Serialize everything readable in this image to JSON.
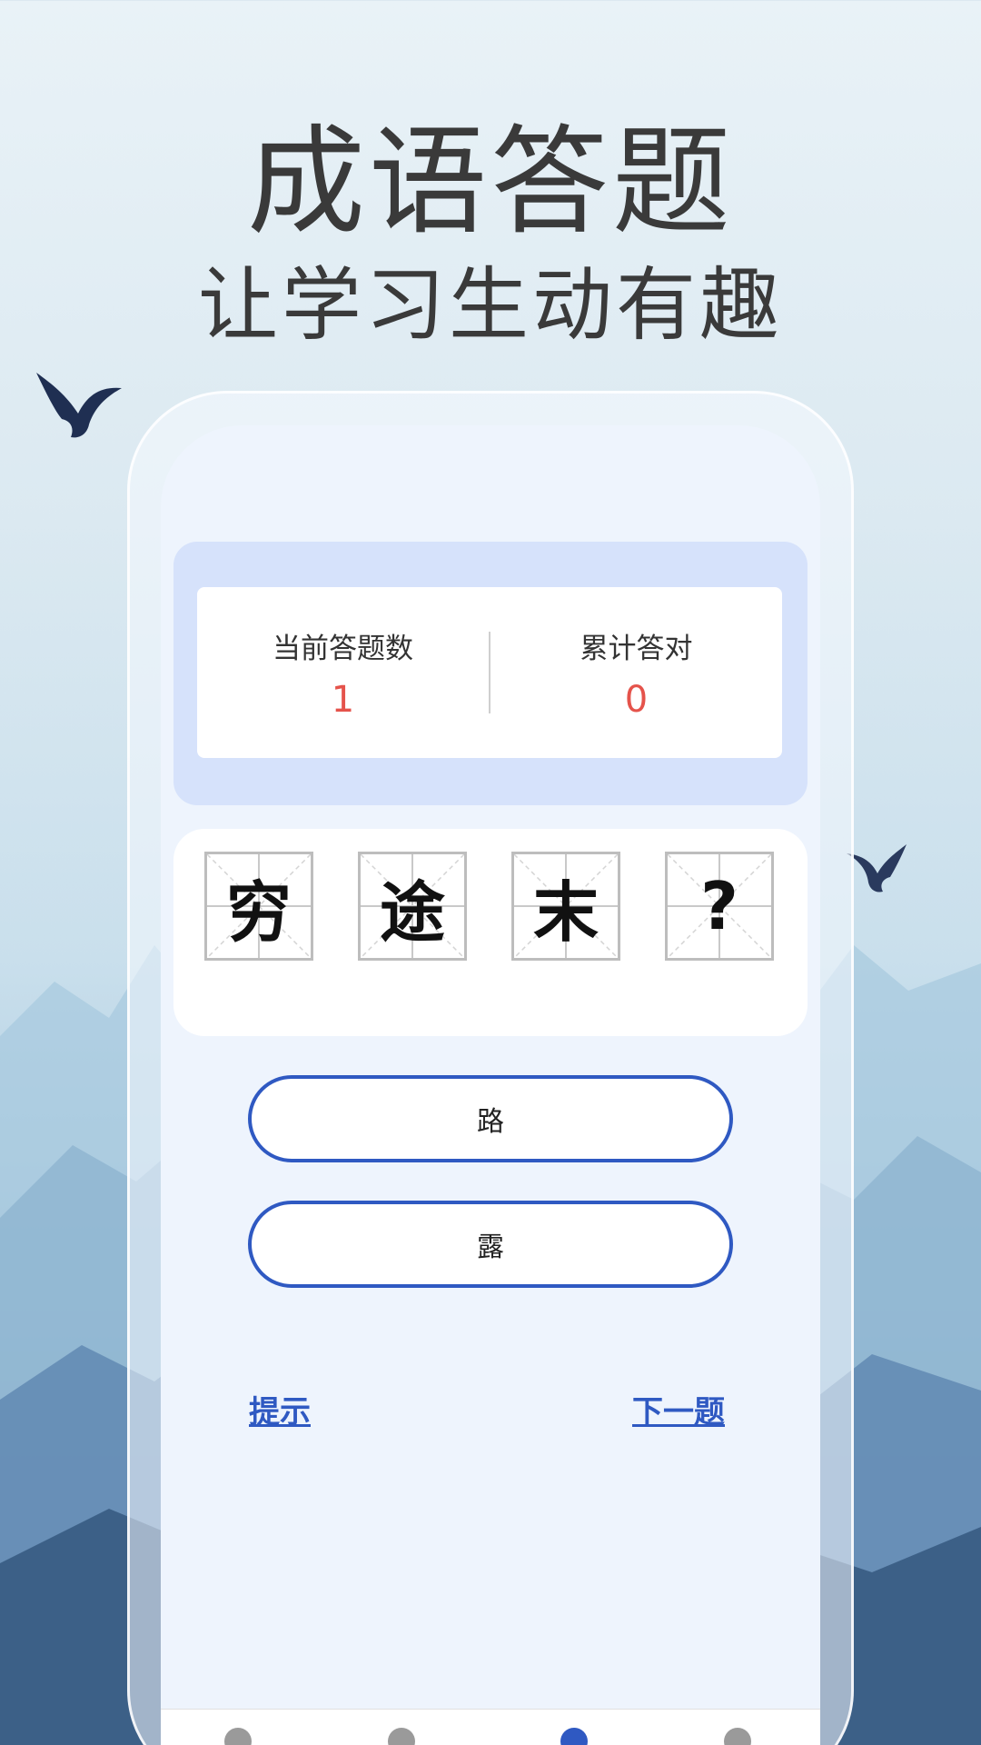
{
  "promo": {
    "headline": "成语答题",
    "subline": "让学习生动有趣"
  },
  "stats": {
    "current_label": "当前答题数",
    "current_value": "1",
    "correct_label": "累计答对",
    "correct_value": "0"
  },
  "idiom": {
    "chars": [
      "穷",
      "途",
      "末",
      "?"
    ]
  },
  "options": [
    "路",
    "露"
  ],
  "actions": {
    "hint": "提示",
    "next": "下一题"
  },
  "colors": {
    "accent": "#2f59c2",
    "count": "#e5534b",
    "panel": "#d6e2fb"
  }
}
